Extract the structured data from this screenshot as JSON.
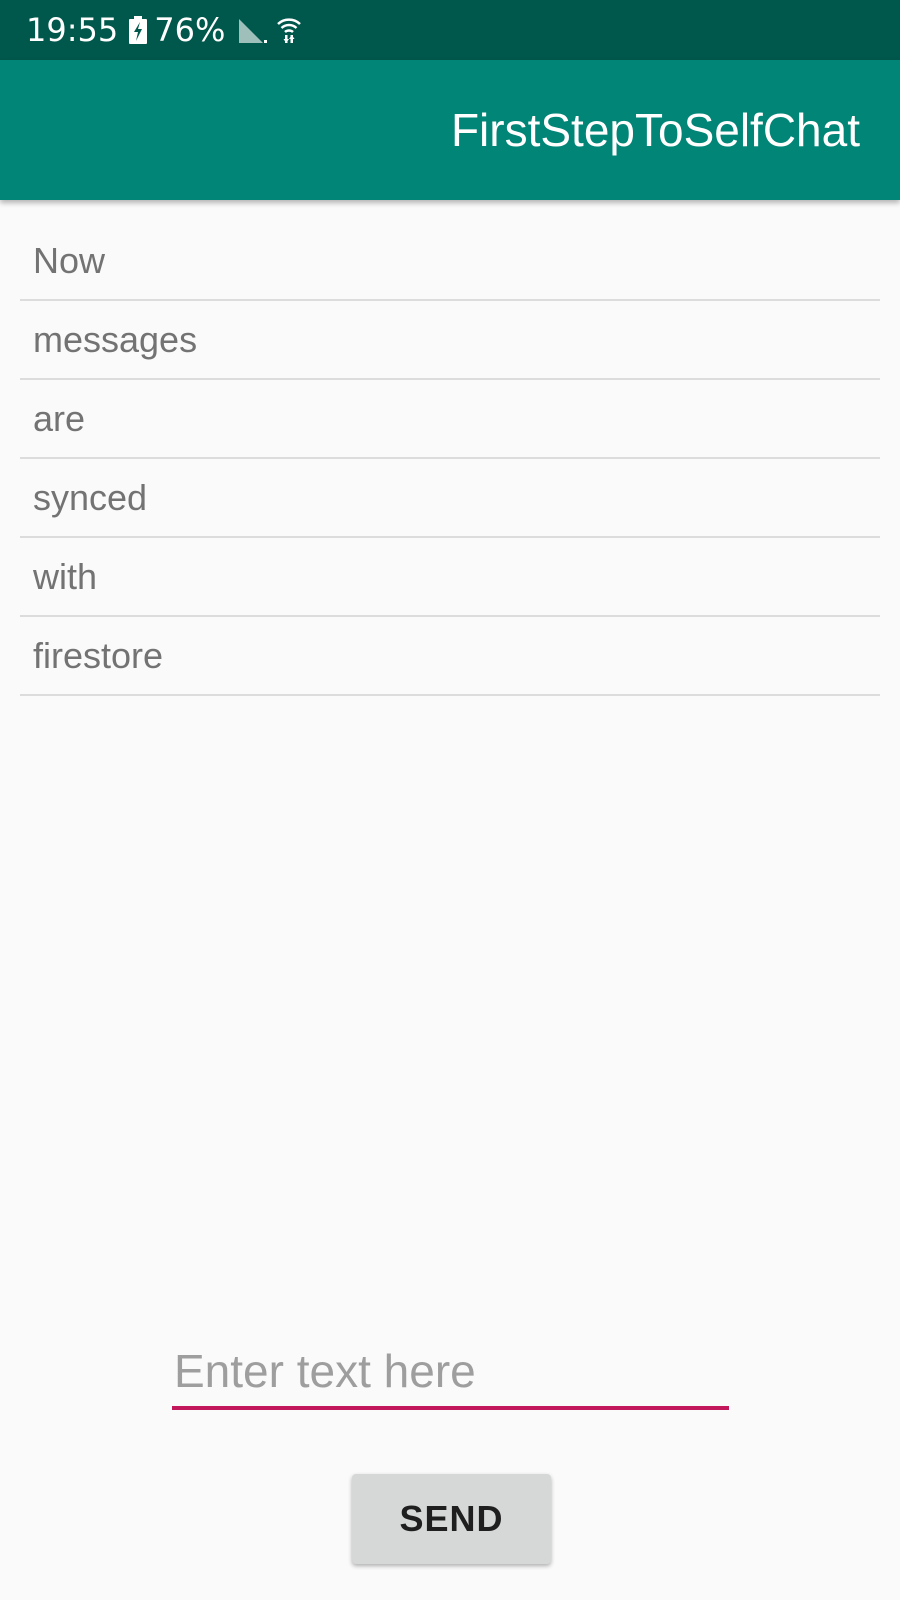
{
  "status_bar": {
    "time": "19:55",
    "battery_percent": "76%",
    "icons": [
      "battery-charging-icon",
      "cell-signal-icon",
      "wifi-icon"
    ]
  },
  "app_bar": {
    "title": "FirstStepToSelfChat"
  },
  "messages": [
    {
      "text": "Now"
    },
    {
      "text": "messages"
    },
    {
      "text": "are"
    },
    {
      "text": "synced"
    },
    {
      "text": "with"
    },
    {
      "text": "firestore"
    }
  ],
  "composer": {
    "placeholder": "Enter text here",
    "value": "",
    "send_label": "SEND"
  },
  "colors": {
    "status_bar": "#00574b",
    "app_bar": "#008577",
    "accent": "#c2185b",
    "background": "#fafafa"
  }
}
